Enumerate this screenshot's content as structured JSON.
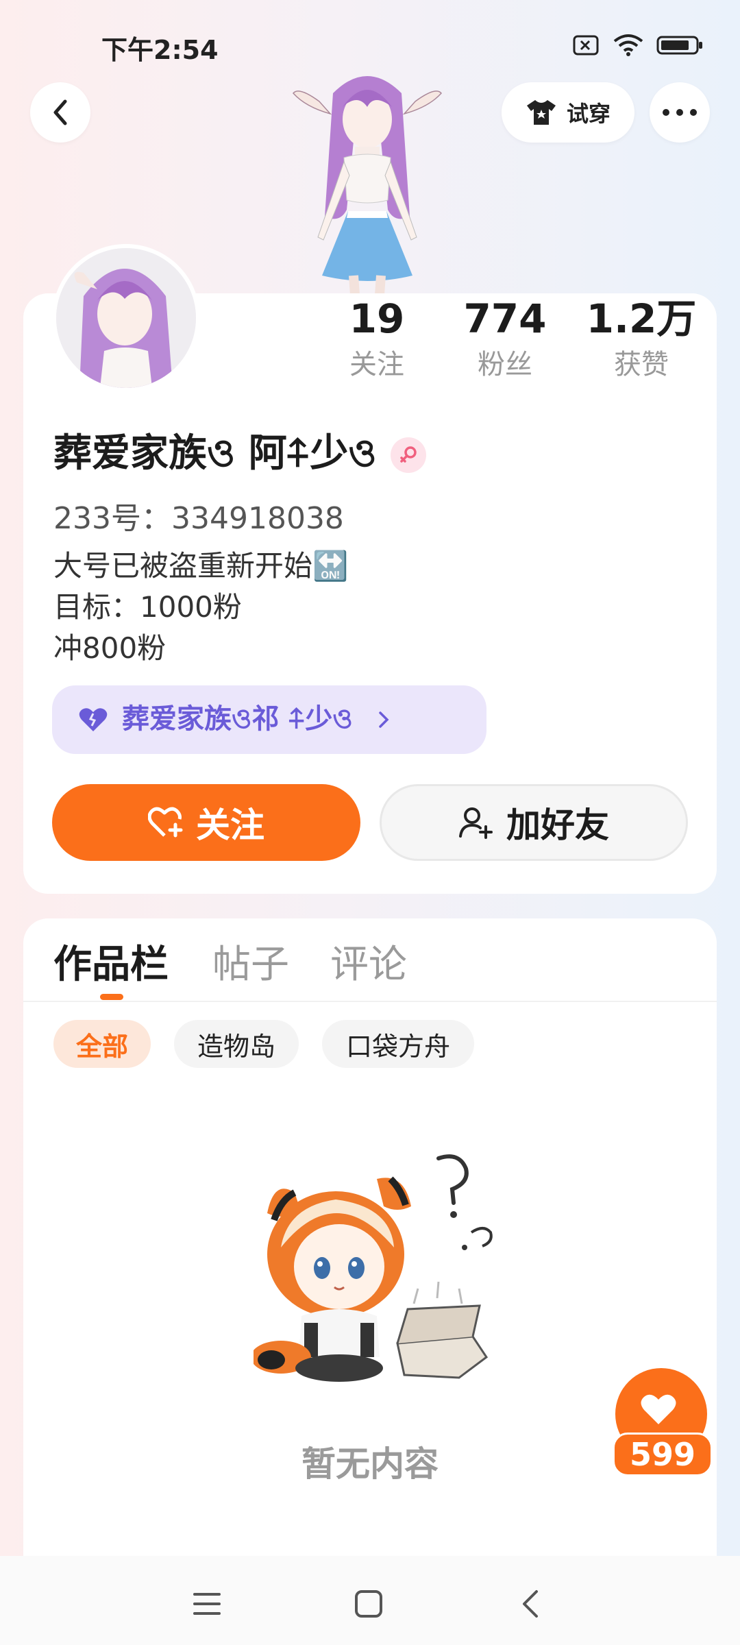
{
  "status_bar": {
    "time": "下午2:54"
  },
  "header": {
    "try_on_label": "试穿"
  },
  "stats": [
    {
      "value": "19",
      "label": "关注"
    },
    {
      "value": "774",
      "label": "粉丝"
    },
    {
      "value": "1.2万",
      "label": "获赞"
    }
  ],
  "profile": {
    "nickname": "葬爱家族ও 阿⍏少ও",
    "uid": "233号：334918038",
    "bio_lines": [
      "大号已被盗重新开始🔛",
      "目标：1000粉",
      "冲800粉"
    ],
    "family_label": "葬爱家族ও祁 ⍏少ও"
  },
  "actions": {
    "follow_label": "关注",
    "add_friend_label": "加好友"
  },
  "tabs": [
    {
      "label": "作品栏"
    },
    {
      "label": "帖子"
    },
    {
      "label": "评论"
    }
  ],
  "filters": [
    {
      "label": "全部"
    },
    {
      "label": "造物岛"
    },
    {
      "label": "口袋方舟"
    }
  ],
  "empty_state": {
    "text": "暂无内容"
  },
  "like_fab": {
    "count": "599"
  },
  "colors": {
    "accent": "#fb6f1a",
    "family_chip_bg": "#ebe6fb",
    "family_text": "#6a5bd8"
  }
}
